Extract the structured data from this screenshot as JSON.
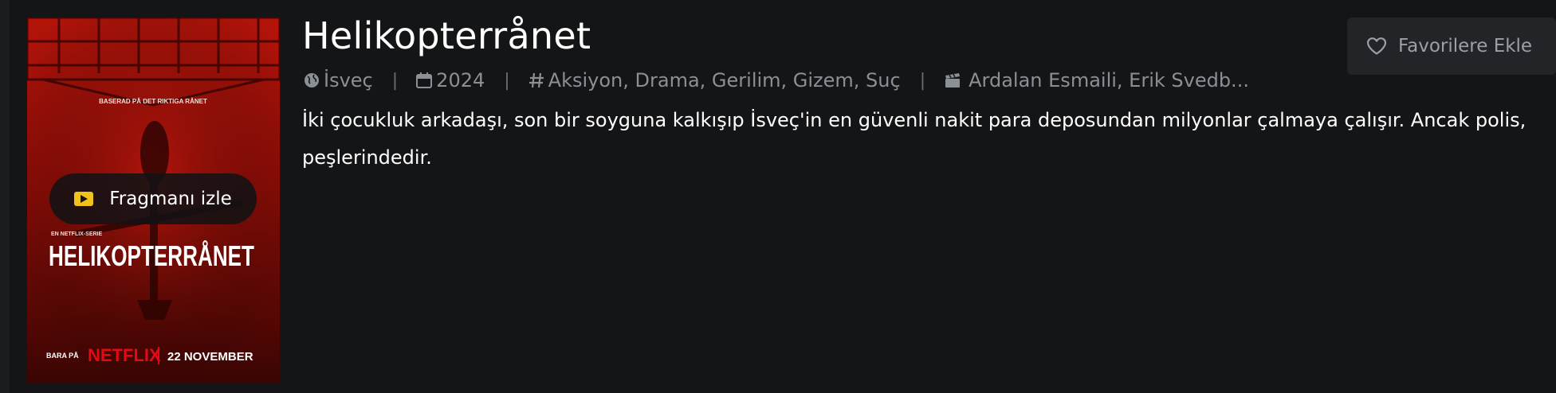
{
  "movie": {
    "title": "Helikopterrånet",
    "country": "İsveç",
    "year": "2024",
    "genres": "Aksiyon, Drama, Gerilim, Gizem, Suç",
    "cast": "Ardalan Esmaili, Erik Svedb...",
    "description_line1": "İki çocukluk arkadaşı, son bir soyguna kalkışıp İsveç'in en güvenli nakit para deposundan milyonlar çalmaya çalışır. Ancak polis,",
    "description_line2": "peşlerindedir."
  },
  "poster": {
    "tagline": "BASERAD PÅ DET RIKTIGA RÅNET",
    "kicker": "EN NETFLIX-SERIE",
    "title_art": "HELIKOPTERRÅNET",
    "prefix": "BARA PÅ",
    "brand": "NETFLIX",
    "date": "22 NOVEMBER"
  },
  "actions": {
    "trailer_label": "Fragmanı izle",
    "favorite_label": "Favorilere Ekle"
  },
  "meta_separator": "|",
  "icons": {
    "country": "globe-icon",
    "year": "calendar-icon",
    "genres": "hash-icon",
    "cast": "clapperboard-icon",
    "trailer": "play-icon",
    "favorite": "heart-icon"
  },
  "colors": {
    "background": "#141517",
    "text_primary": "#ffffff",
    "text_muted": "#8b8f96",
    "accent": "#f2c21b",
    "netflix_red": "#e50914"
  }
}
